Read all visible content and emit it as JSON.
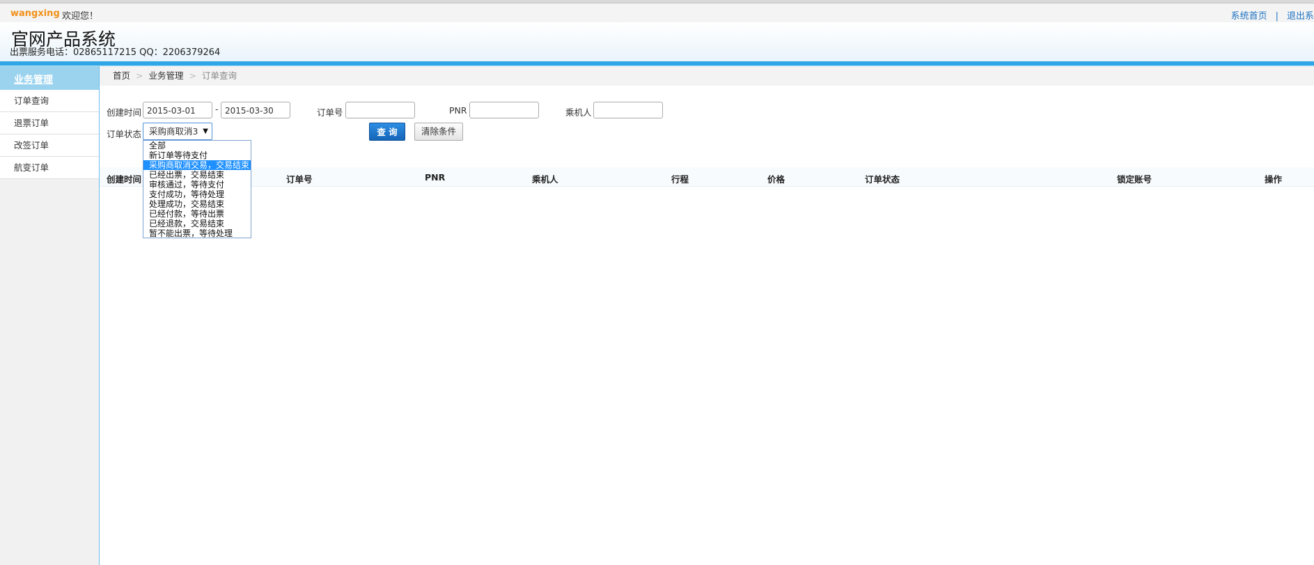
{
  "topbar": {
    "username": "wangxing",
    "welcome": "欢迎您！",
    "home_link": "系统首页",
    "separator": "|",
    "logout_link": "退出系"
  },
  "header": {
    "title": "官网产品系统",
    "subtitle": "出票服务电话：02865117215 QQ：2206379264"
  },
  "sidebar": {
    "title": "业务管理",
    "items": [
      {
        "label": "订单查询"
      },
      {
        "label": "退票订单"
      },
      {
        "label": "改签订单"
      },
      {
        "label": "航变订单"
      }
    ]
  },
  "breadcrumb": {
    "home": "首页",
    "section": "业务管理",
    "current": "订单查询",
    "arrow": ">"
  },
  "filters": {
    "created_label": "创建时间",
    "date_from": "2015-03-01",
    "dash": "-",
    "date_to": "2015-03-30",
    "order_no_label": "订单号",
    "order_no_value": "",
    "pnr_label": "PNR",
    "pnr_value": "",
    "passenger_label": "乘机人",
    "passenger_value": "",
    "status_label": "订单状态",
    "status_selected": "采购商取消3",
    "query_button": "查 询",
    "clear_button": "清除条件"
  },
  "status_options": [
    "全部",
    "新订单等待支付",
    "采购商取消交易，交易结束",
    "已经出票，交易结束",
    "审核通过，等待支付",
    "支付成功，等待处理",
    "处理成功，交易结束",
    "已经付款，等待出票",
    "已经退款，交易结束",
    "暂不能出票，等待处理"
  ],
  "selected_option_index": 2,
  "table": {
    "columns": [
      "创建时间",
      "订单号",
      "PNR",
      "乘机人",
      "行程",
      "价格",
      "订单状态",
      "锁定账号",
      "操作"
    ]
  },
  "colors": {
    "accent": "#31a6e6",
    "username": "#f29018",
    "link": "#1f73c2",
    "query_button": "#1565b8",
    "selected_option": "#1e90ff"
  },
  "icons": {
    "breadcrumb_arrow": "chevron-right-icon",
    "select_arrow": "triangle-down-icon"
  }
}
